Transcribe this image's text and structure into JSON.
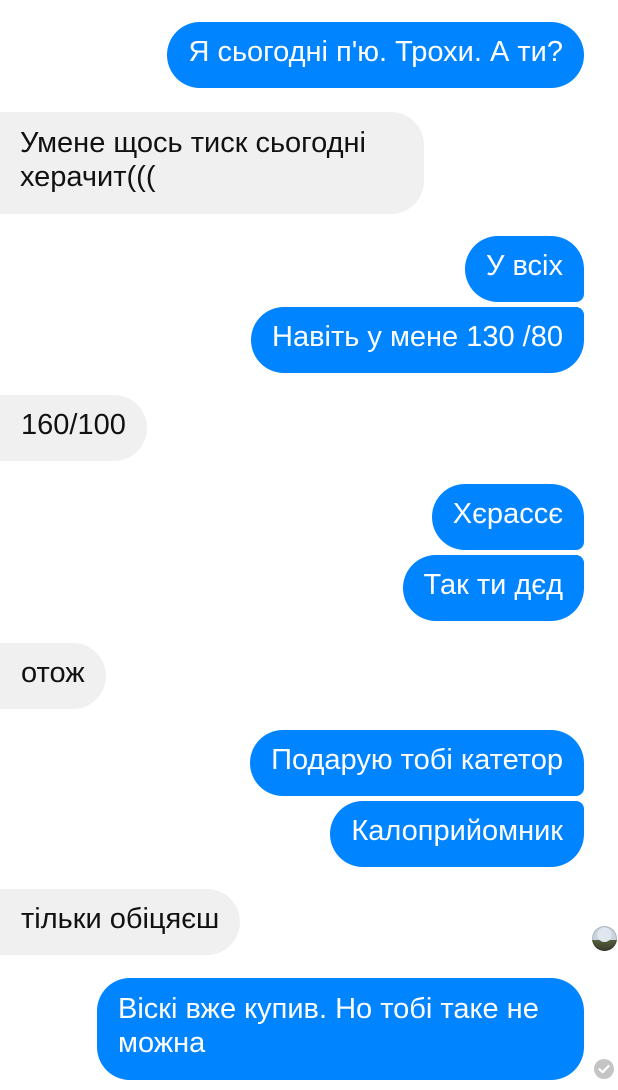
{
  "messages": [
    {
      "from": "me",
      "text": "Я сьогодні п'ю. Трохи. А ти?"
    },
    {
      "from": "them",
      "text": "Умене щось тиск сьогодні херачит((("
    },
    {
      "from": "me",
      "text": "У всіх"
    },
    {
      "from": "me",
      "text": "Навіть у мене 130 /80"
    },
    {
      "from": "them",
      "text": "160/100"
    },
    {
      "from": "me",
      "text": "Хєрассє"
    },
    {
      "from": "me",
      "text": "Так ти дєд"
    },
    {
      "from": "them",
      "text": "отож"
    },
    {
      "from": "me",
      "text": "Подарую тобі катетор"
    },
    {
      "from": "me",
      "text": "Калоприйомник"
    },
    {
      "from": "them",
      "text": "тільки обіцяєш"
    },
    {
      "from": "me",
      "text": "Віскі вже купив. Но тобі таке не можна"
    }
  ],
  "colors": {
    "outgoing_bubble": "#0084ff",
    "incoming_bubble": "#f1f0f0",
    "outgoing_text": "#ffffff",
    "incoming_text": "#111111"
  },
  "status_icons": {
    "seen": "seen-avatar",
    "delivered": "check-circle-icon"
  }
}
